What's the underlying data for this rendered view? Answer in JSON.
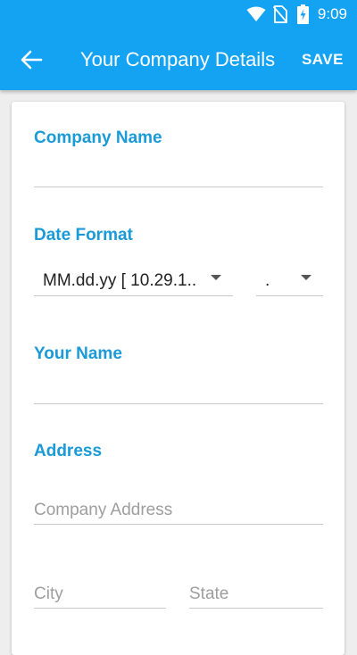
{
  "status": {
    "time": "9:09"
  },
  "toolbar": {
    "title": "Your Company Details",
    "save_label": "SAVE"
  },
  "form": {
    "company_name_label": "Company Name",
    "company_name_value": "",
    "date_format_label": "Date Format",
    "date_format_value": "MM.dd.yy [ 10.29.1..",
    "date_separator_value": ".",
    "your_name_label": "Your Name",
    "your_name_value": "",
    "address_label": "Address",
    "company_address_placeholder": "Company Address",
    "city_placeholder": "City",
    "state_placeholder": "State"
  }
}
